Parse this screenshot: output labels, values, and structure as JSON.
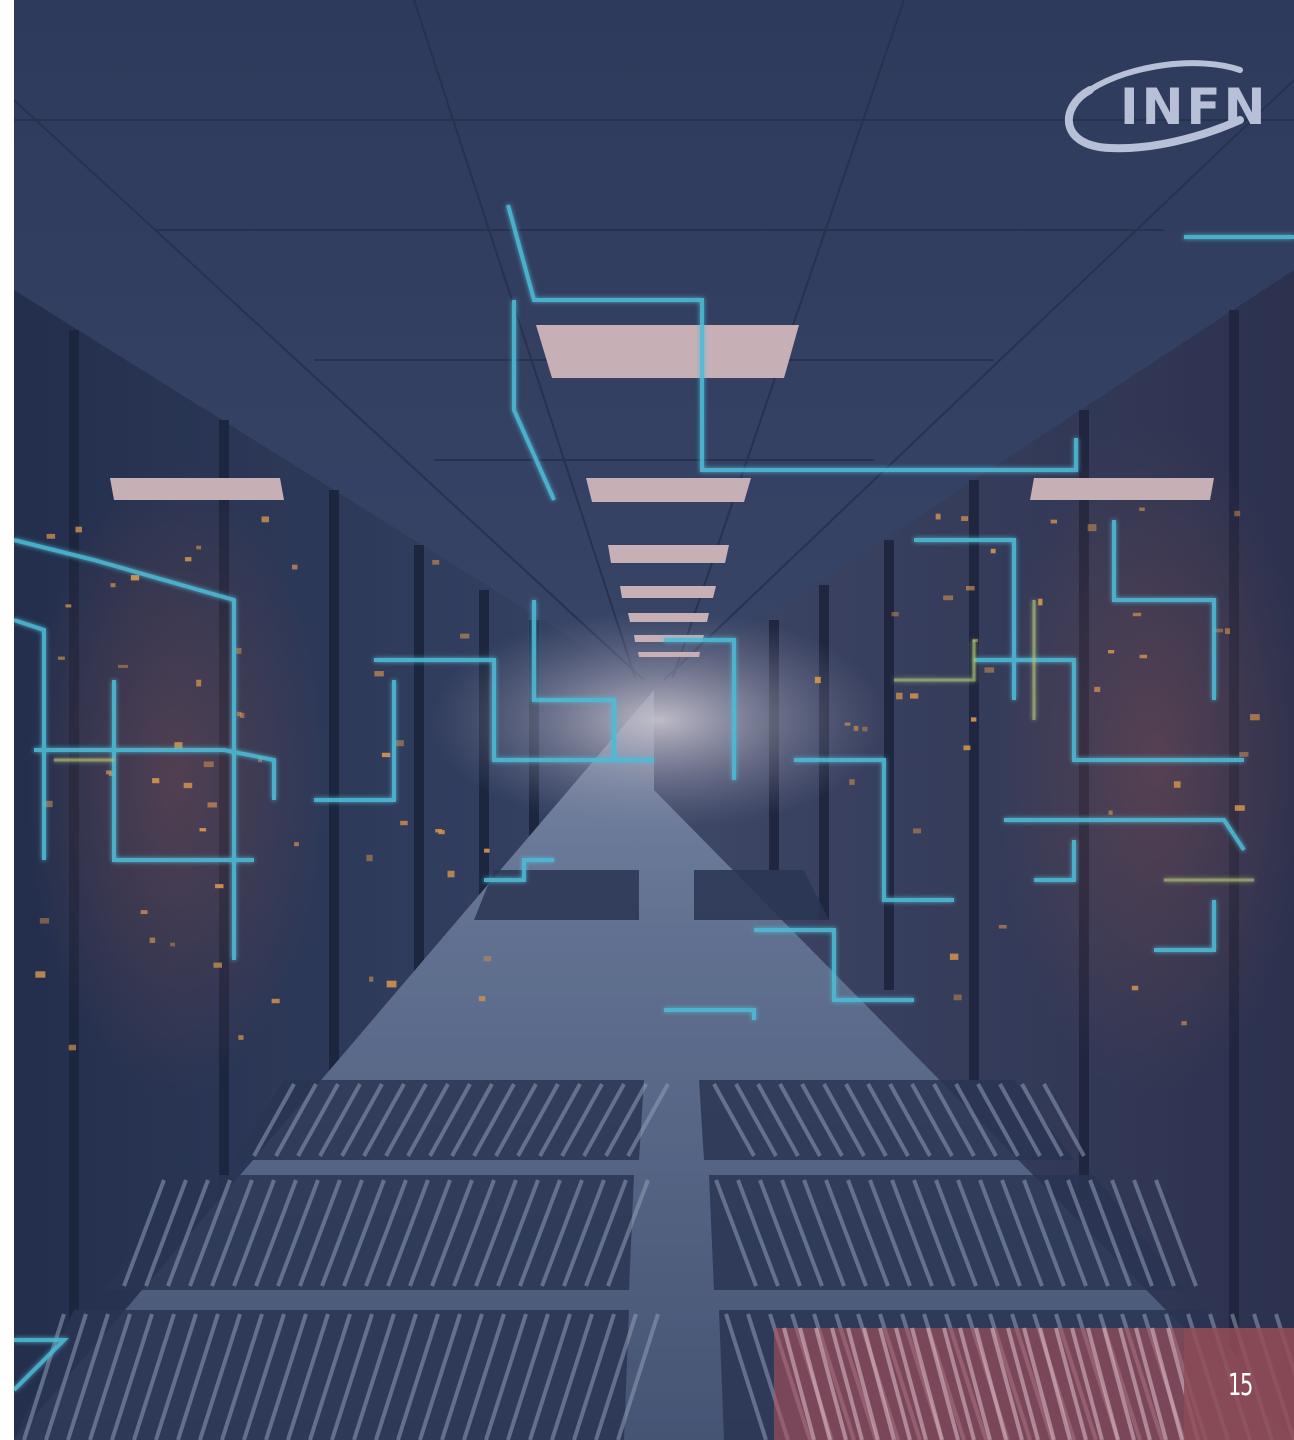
{
  "logo": {
    "text": "INFN",
    "color": "#b7c0d6"
  },
  "page_number": "15",
  "palette": {
    "ceiling": "#303c5c",
    "floor": "#5a6a86",
    "network_lines": "#57d7f0",
    "ceiling_lights": "#e9c9c9",
    "server_leds": "#f0a24a",
    "accent_block": "#9a4e5a"
  },
  "icons": {
    "logo": "infn-logo"
  }
}
